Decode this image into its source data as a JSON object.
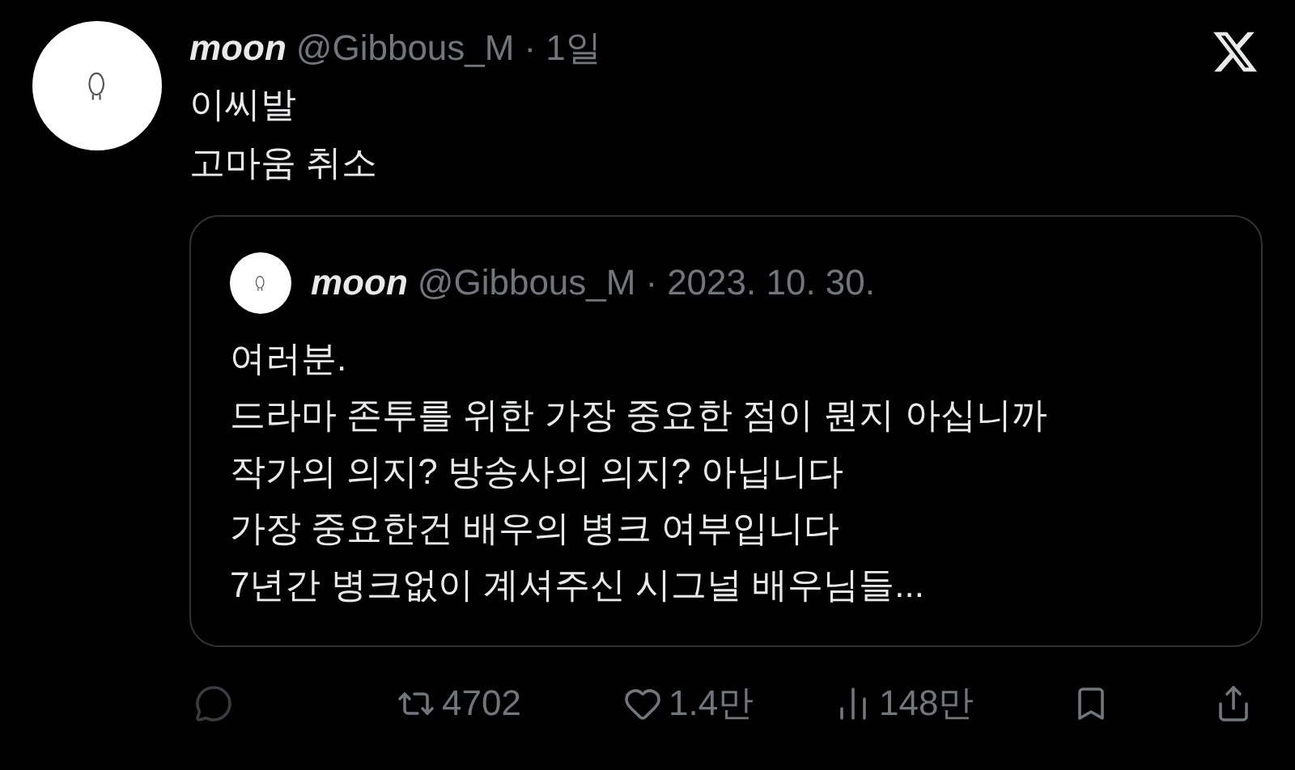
{
  "post": {
    "author_name": "moon",
    "handle": "@Gibbous_M",
    "separator": "·",
    "time": "1일",
    "lines": [
      "이씨발",
      "고마움 취소"
    ]
  },
  "quote": {
    "author_name": "moon",
    "handle": "@Gibbous_M",
    "separator": "·",
    "time": "2023. 10. 30.",
    "lines": [
      "여러분.",
      "드라마 존투를 위한 가장 중요한 점이 뭔지 아십니까",
      "작가의 의지? 방송사의 의지? 아닙니다",
      "가장 중요한건 배우의 병크 여부입니다",
      "7년간 병크없이 계셔주신 시그널 배우님들..."
    ]
  },
  "actions": [
    {
      "kind": "reply"
    },
    {
      "kind": "repost",
      "count": "4702"
    },
    {
      "kind": "like",
      "count": "1.4만"
    },
    {
      "kind": "views",
      "count": "148만"
    },
    {
      "kind": "bookmark"
    },
    {
      "kind": "share"
    }
  ]
}
